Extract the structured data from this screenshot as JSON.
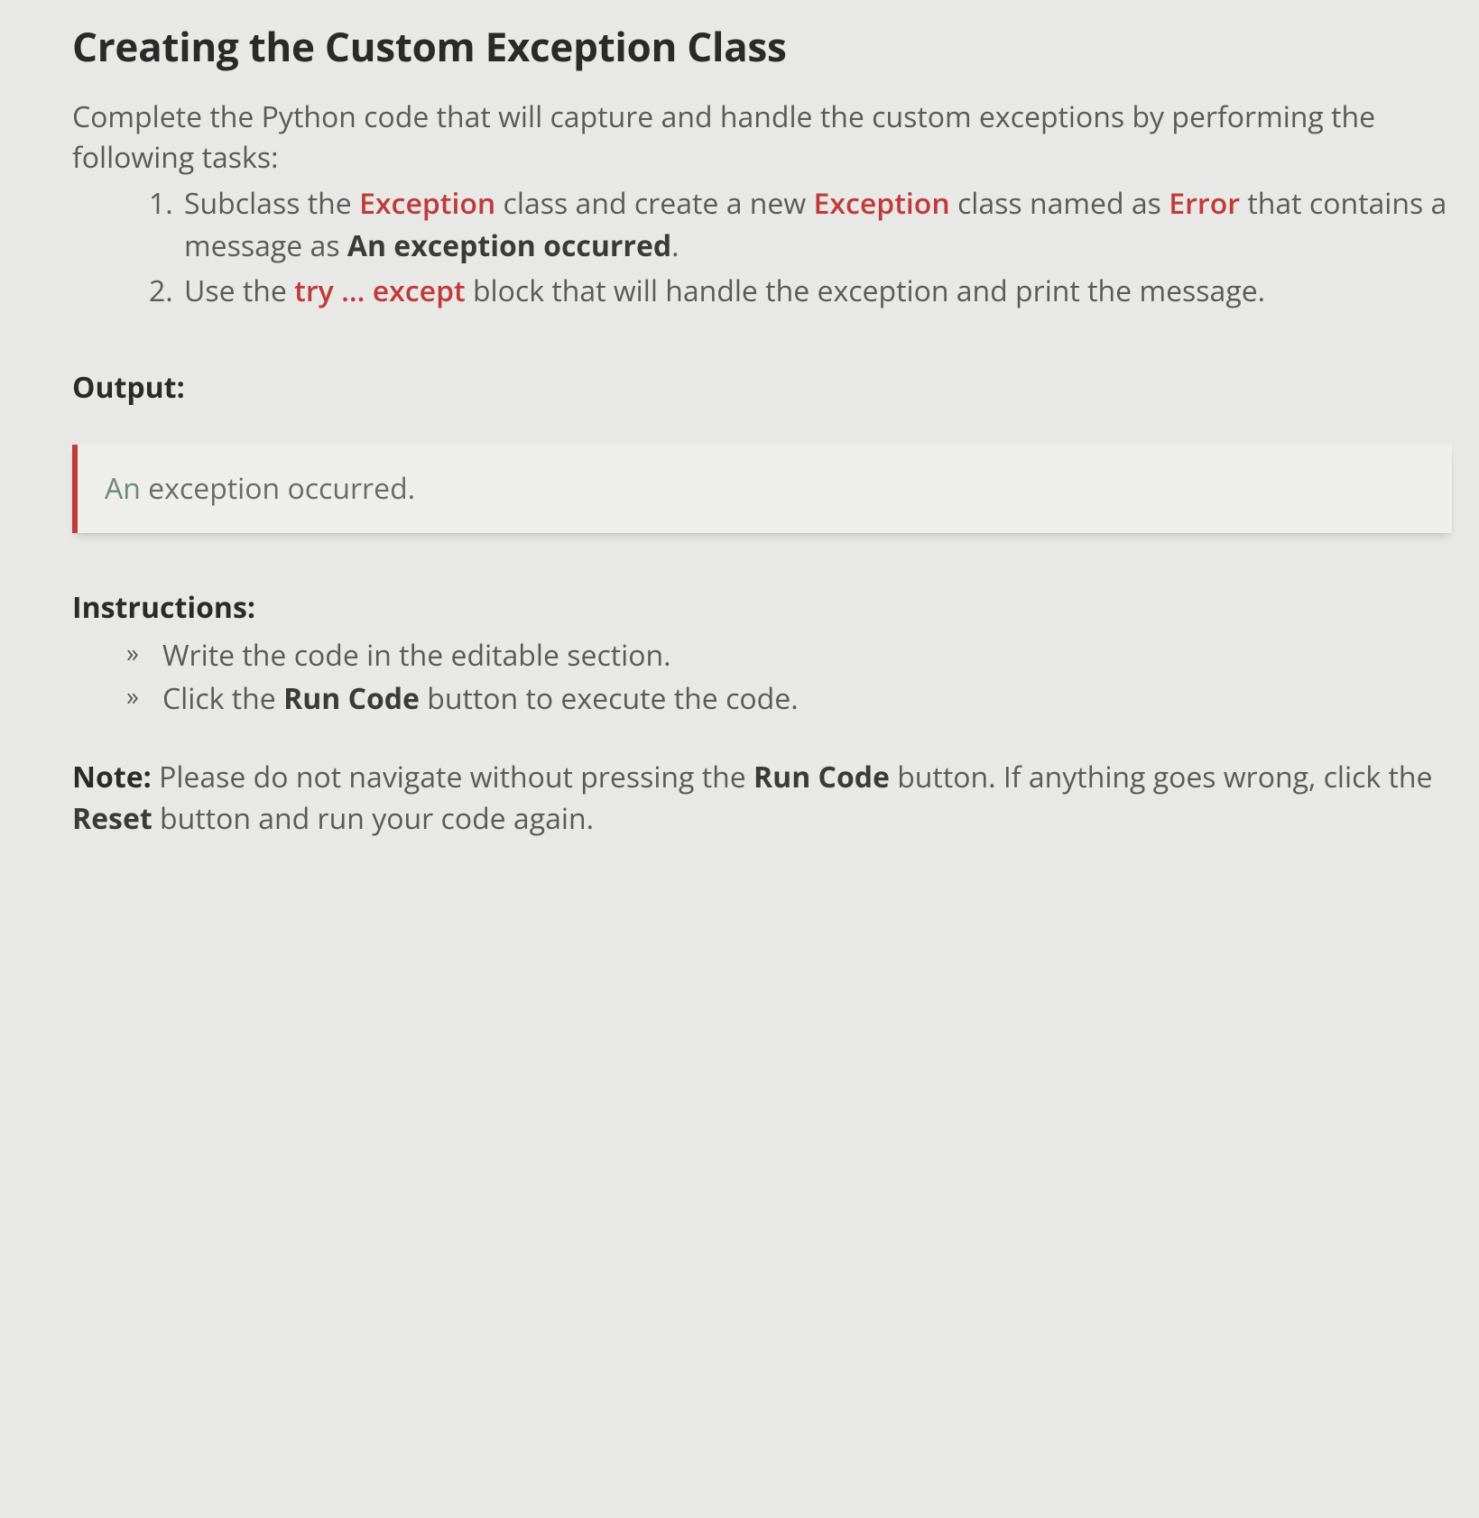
{
  "heading": "Creating the Custom Exception Class",
  "intro": "Complete the Python code that will capture and handle the custom exceptions by performing the following tasks:",
  "tasks": [
    {
      "pre1": "Subclass the ",
      "kw1": "Exception",
      "mid1": " class and create a new ",
      "kw2": "Exception",
      "mid2": " class named as ",
      "kw3": "Error",
      "mid3": " that contains a message as ",
      "bold1": "An exception occurred",
      "post": "."
    },
    {
      "pre1": "Use the ",
      "kw1": "try ... except",
      "mid1": " block that will handle the exception and print the message.",
      "kw2": "",
      "mid2": "",
      "kw3": "",
      "mid3": "",
      "bold1": "",
      "post": ""
    }
  ],
  "output_label": "Output:",
  "output_first": "An",
  "output_rest": " exception occurred.",
  "instructions_label": "Instructions:",
  "instructions": [
    {
      "pre": "Write the code in the editable section.",
      "bold1": "",
      "mid": "",
      "bold2": "",
      "post": ""
    },
    {
      "pre": "Click the ",
      "bold1": "Run Code",
      "mid": " button to execute the code.",
      "bold2": "",
      "post": ""
    }
  ],
  "note_label": "Note:",
  "note_pre": " Please do not navigate without pressing the ",
  "note_bold1": "Run Code",
  "note_mid": " button. If anything goes wrong, click the ",
  "note_bold2": "Reset",
  "note_post": " button and run your code again."
}
